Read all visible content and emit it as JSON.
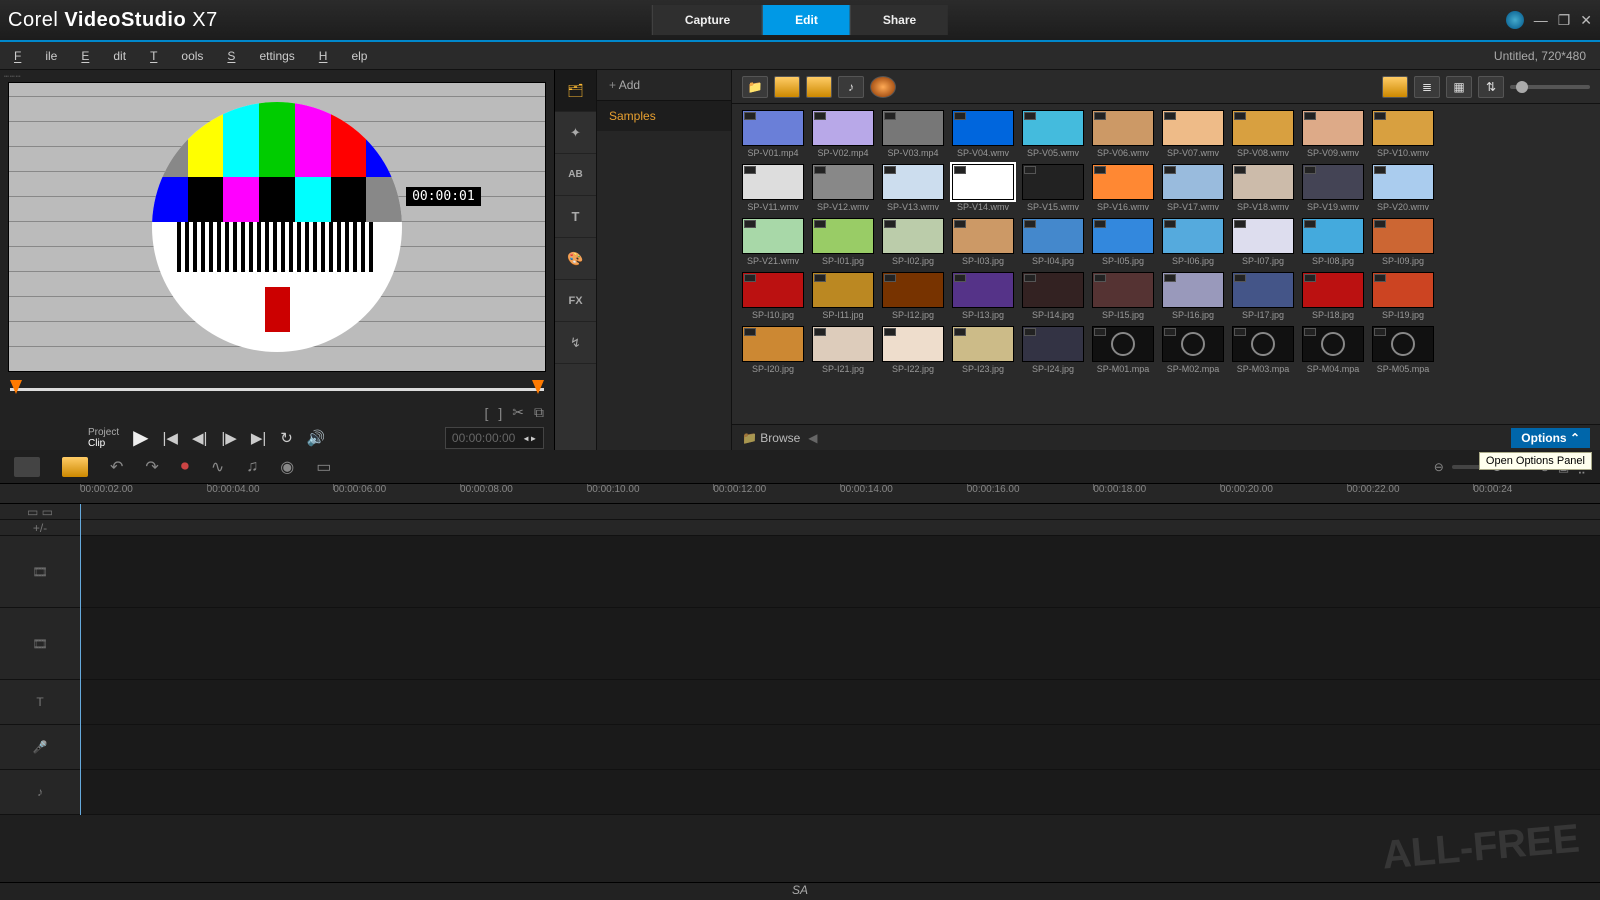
{
  "title": {
    "brand": "Corel",
    "product": "VideoStudio",
    "ver": "X7"
  },
  "modes": [
    "Capture",
    "Edit",
    "Share"
  ],
  "active_mode": 1,
  "menu": [
    "File",
    "Edit",
    "Tools",
    "Settings",
    "Help"
  ],
  "status": "Untitled, 720*480",
  "preview": {
    "timecode_overlay": "00:00:01",
    "project_label": "Project",
    "clip_label": "Clip",
    "tc": "00:00:00:00"
  },
  "library": {
    "add": "Add",
    "tree": [
      "Samples"
    ],
    "side_tabs": [
      "media",
      "transition",
      "title",
      "text",
      "graphic",
      "fx",
      "path"
    ],
    "footer_browse": "Browse",
    "footer_options": "Options",
    "tooltip": "Open Options Panel",
    "selected": "SP-V14.wmv",
    "rows": [
      [
        "SP-V01.mp4",
        "SP-V02.mp4",
        "SP-V03.mp4",
        "SP-V04.wmv",
        "SP-V05.wmv",
        "SP-V06.wmv",
        "SP-V07.wmv",
        "SP-V08.wmv",
        "SP-V09.wmv",
        "SP-V10.wmv"
      ],
      [
        "SP-V11.wmv",
        "SP-V12.wmv",
        "SP-V13.wmv",
        "SP-V14.wmv",
        "SP-V15.wmv",
        "SP-V16.wmv",
        "SP-V17.wmv",
        "SP-V18.wmv",
        "SP-V19.wmv",
        "SP-V20.wmv"
      ],
      [
        "SP-V21.wmv",
        "SP-I01.jpg",
        "SP-I02.jpg",
        "SP-I03.jpg",
        "SP-I04.jpg",
        "SP-I05.jpg",
        "SP-I06.jpg",
        "SP-I07.jpg",
        "SP-I08.jpg",
        "SP-I09.jpg"
      ],
      [
        "SP-I10.jpg",
        "SP-I11.jpg",
        "SP-I12.jpg",
        "SP-I13.jpg",
        "SP-I14.jpg",
        "SP-I15.jpg",
        "SP-I16.jpg",
        "SP-I17.jpg",
        "SP-I18.jpg",
        "SP-I19.jpg"
      ],
      [
        "SP-I20.jpg",
        "SP-I21.jpg",
        "SP-I22.jpg",
        "SP-I23.jpg",
        "SP-I24.jpg",
        "SP-M01.mpa",
        "SP-M02.mpa",
        "SP-M03.mpa",
        "SP-M04.mpa",
        "SP-M05.mpa"
      ]
    ]
  },
  "timeline": {
    "ruler": [
      "00:00:02.00",
      "00:00:04.00",
      "00:00:06.00",
      "00:00:08.00",
      "00:00:10.00",
      "00:00:12.00",
      "00:00:14.00",
      "00:00:16.00",
      "00:00:18.00",
      "00:00:20.00",
      "00:00:22.00",
      "00:00:24"
    ],
    "footer": "SA"
  },
  "thumb_colors": [
    "#6a7fd8",
    "#b8a8e8",
    "#777",
    "#06d",
    "#4bd",
    "#c96",
    "#eb8",
    "#d8a040",
    "#da8",
    "#d8a040",
    "#ddd",
    "#888",
    "#cde",
    "#fff",
    "#222",
    "#f83",
    "#9bd",
    "#cba",
    "#445",
    "#ace",
    "#a8d8a8",
    "#9c6",
    "#bca",
    "#c96",
    "#48c",
    "#38d",
    "#5ad",
    "#dde",
    "#4ad",
    "#c63",
    "#b11",
    "#b82",
    "#730",
    "#538",
    "#322",
    "#533",
    "#99b",
    "#458",
    "#b11",
    "#c42",
    "#c83",
    "#dcb",
    "#edc",
    "#cb8",
    "#334",
    "#111",
    "#111",
    "#111",
    "#111",
    "#111"
  ]
}
